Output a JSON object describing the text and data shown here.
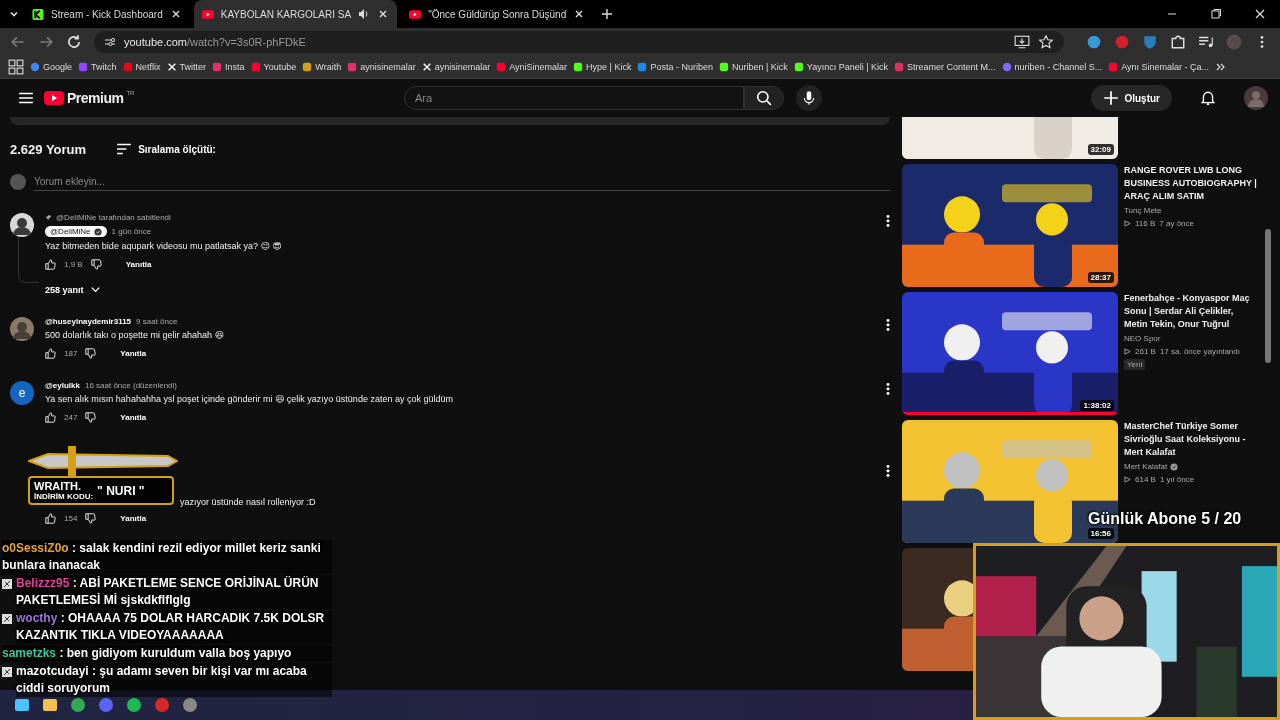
{
  "browser": {
    "tabs": [
      {
        "title": "Stream - Kick Dashboard",
        "kind": "kick",
        "selected": false,
        "audio": false
      },
      {
        "title": "KAYBOLAN KARGOLARI SA",
        "kind": "youtube",
        "selected": true,
        "audio": true
      },
      {
        "title": "\"Önce Güldürüp Sonra Düşünd",
        "kind": "youtube",
        "selected": false,
        "audio": false
      }
    ],
    "url_host": "youtube.com",
    "url_path": "/watch?v=3s0R-phFDkE",
    "bookmarks": [
      {
        "label": "Google",
        "kind": "google"
      },
      {
        "label": "Twitch",
        "kind": "twitch"
      },
      {
        "label": "Netflix",
        "kind": "netflix"
      },
      {
        "label": "Twitter",
        "kind": "x"
      },
      {
        "label": "Insta",
        "kind": "instagram"
      },
      {
        "label": "Youtube",
        "kind": "youtube"
      },
      {
        "label": "Wraith",
        "kind": "wraith"
      },
      {
        "label": "aynisinemalar",
        "kind": "instagram"
      },
      {
        "label": "aynisinemalar",
        "kind": "x"
      },
      {
        "label": "AyniSinemalar",
        "kind": "youtube"
      },
      {
        "label": "Hype | Kick",
        "kind": "kick"
      },
      {
        "label": "Posta - Nuriben",
        "kind": "mail"
      },
      {
        "label": "Nuriben | Kick",
        "kind": "kick"
      },
      {
        "label": "Yayıncı Paneli | Kick",
        "kind": "kick"
      },
      {
        "label": "Streamer Content M...",
        "kind": "streamer"
      },
      {
        "label": "nuriben - Channel S...",
        "kind": "swirl"
      },
      {
        "label": "Aynı Sinemalar - Ça...",
        "kind": "youtube"
      }
    ]
  },
  "youtube": {
    "logo": "Premium",
    "region": "TR",
    "search_placeholder": "Ara",
    "create": "Oluştur"
  },
  "comments": {
    "count": "2.629 Yorum",
    "sort": "Sıralama ölçütü:",
    "add_placeholder": "Yorum ekleyin...",
    "items": [
      {
        "pinned": "@DeliMiNe tarafından sabitlendi",
        "author": "@DeliMiNe",
        "creator": true,
        "time": "1 gün önce",
        "text": "Yaz bitmeden bide aqupark videosu mu patlatsak ya? 😉 😎",
        "likes": "1,9 B",
        "reply": "Yanıtla",
        "replies": "258 yanıt"
      },
      {
        "author": "@huseyinaydemir3115",
        "creator": false,
        "time": "9 saat önce",
        "text": "500 dolarlık takı o poşette mi gelir ahahah 😆",
        "likes": "187",
        "reply": "Yanıtla"
      },
      {
        "author": "@eylulkk",
        "creator": false,
        "time": "16 saat önce (düzenlendi)",
        "text": "Ya sen alık mısın hahahahha ysl poşet içinde gönderir mi 😆 çelik yazıyo üstünde zaten ay çok güldüm",
        "likes": "247",
        "reply": "Yanıtla",
        "kind": "letter",
        "letter": "e"
      },
      {
        "text": "yazıyor üstünde nasıl rolleniyor :D",
        "likes": "154",
        "reply": "Yanıtla",
        "kind": "hidden"
      }
    ]
  },
  "sidebar": [
    {
      "duration": "32:09",
      "cut": true
    },
    {
      "duration": "28:37",
      "title": "RANGE ROVER LWB LONG BUSINESS AUTOBIOGRAPHY | ARAÇ ALIM SATIM",
      "channel": "Tunç Mete",
      "views": "116 B",
      "age": "7 ay önce"
    },
    {
      "duration": "1:38:02",
      "title": "Fenerbahçe - Konyaspor Maç Sonu | Serdar Ali Çelikler, Metin Tekin, Onur Tuğrul",
      "channel": "NEO Spor",
      "views": "261 B",
      "age": "17 sa. önce yayınlandı",
      "badge": "Yeni",
      "level": 1
    },
    {
      "duration": "16:56",
      "title": "MasterChef Türkiye Somer Sivrioğlu Saat Koleksiyonu - Mert Kalafat",
      "channel": "Mert Kalafat",
      "verified": true,
      "views": "614 B",
      "age": "1 yıl önce"
    },
    {
      "kind": "picture"
    }
  ],
  "overlays": {
    "sponsor_brand": "WRAITH.",
    "sponsor_code_label": "İNDİRİM KODU:",
    "sponsor_code": "\" NURI \"",
    "subscriber_goal": "Günlük Abone 5 / 20",
    "chat": [
      {
        "user": "o0SessiZ0o",
        "color": "#e8a33a",
        "badge": false,
        "text": ": salak kendini rezil ediyor millet keriz sanki bunlara inanacak"
      },
      {
        "user": "Belizzz95",
        "color": "#e0409a",
        "badge": true,
        "text": ": ABİ PAKETLEME SENCE ORİJİNAL ÜRÜN PAKETLEMESİ Mİ sjskdkflflglg"
      },
      {
        "user": "wocthy",
        "color": "#a070e0",
        "badge": true,
        "text": ": OHAAAA 75 DOLAR HARCADIK 7.5K DOLSR KAZANTIK TIKLA VIDEOYAAAAAAA"
      },
      {
        "user": "sametzks",
        "color": "#3ec9a0",
        "badge": false,
        "text": ": ben gidiyom kuruldum valla boş yapıyo"
      },
      {
        "user": "mazotcudayi",
        "color": "#ffffff",
        "badge": true,
        "text": ": şu adamı seven bir kişi var mı acaba ciddi soruyorum"
      }
    ]
  },
  "taskbar": [
    {
      "kind": "start"
    },
    {
      "kind": "folder"
    },
    {
      "kind": "browser"
    },
    {
      "kind": "discord"
    },
    {
      "kind": "music"
    },
    {
      "kind": "red"
    },
    {
      "kind": "recorder"
    }
  ]
}
